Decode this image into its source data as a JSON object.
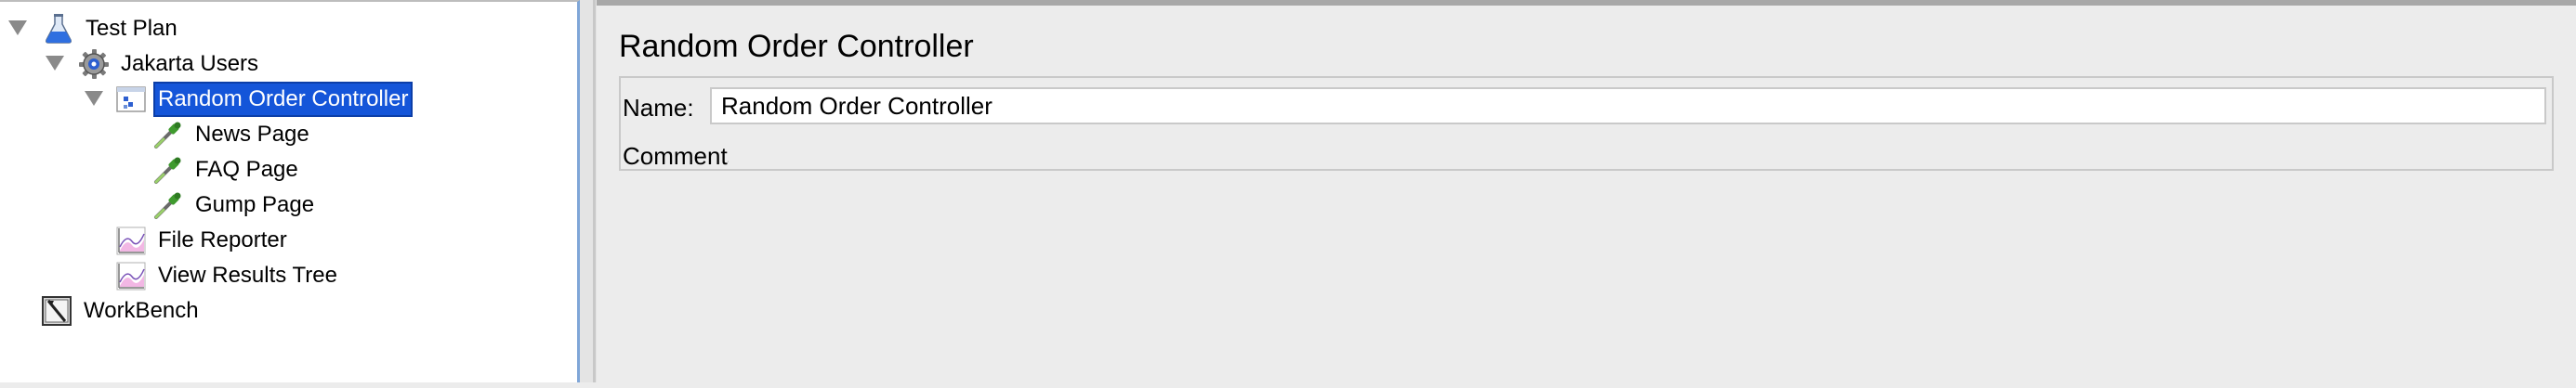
{
  "tree": {
    "nodes": [
      {
        "label": "Test Plan",
        "icon": "flask-icon",
        "expanded": true
      },
      {
        "label": "Jakarta Users",
        "icon": "gear-icon",
        "expanded": true
      },
      {
        "label": "Random Order Controller",
        "icon": "controller-icon",
        "expanded": true,
        "selected": true
      },
      {
        "label": "News Page",
        "icon": "pipette-icon"
      },
      {
        "label": "FAQ Page",
        "icon": "pipette-icon"
      },
      {
        "label": "Gump Page",
        "icon": "pipette-icon"
      },
      {
        "label": "File Reporter",
        "icon": "chart-icon"
      },
      {
        "label": "View Results Tree",
        "icon": "chart-icon"
      },
      {
        "label": "WorkBench",
        "icon": "workbench-icon"
      }
    ]
  },
  "panel": {
    "title": "Random Order Controller",
    "name_label": "Name:",
    "name_value": "Random Order Controller",
    "comments_label": "Comments:",
    "comments_value": ""
  },
  "colors": {
    "selection": "#1455d9",
    "tree_border": "#7fa6d8",
    "panel_bg": "#ececec"
  }
}
